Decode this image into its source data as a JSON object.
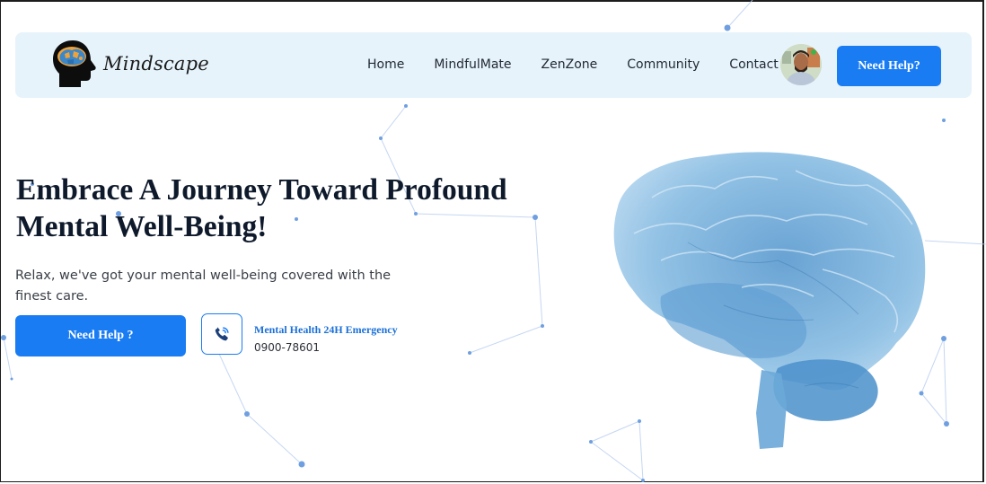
{
  "brand": {
    "name": "Mindscape",
    "logo_icon": "head-puzzle-brain-icon"
  },
  "nav": {
    "links": [
      "Home",
      "MindfulMate",
      "ZenZone",
      "Community",
      "Contact"
    ],
    "avatar_icon": "user-avatar",
    "cta_label": "Need Help?"
  },
  "hero": {
    "title": "Embrace A Journey Toward Profound Mental Well-Being!",
    "subtitle": "Relax, we've got your mental well-being covered with the finest care.",
    "cta_label": "Need Help ?",
    "phone_icon": "phone-call-icon",
    "emergency_label": "Mental Health 24H Emergency",
    "emergency_number": "0900-78601",
    "illustration": "brain-3d-illustration"
  },
  "colors": {
    "accent": "#1a7cf3",
    "navbar_bg": "#e6f3fb",
    "title": "#0e1a2b",
    "brain": "#5fa3d6",
    "network_dots": "#6f9fe0"
  }
}
